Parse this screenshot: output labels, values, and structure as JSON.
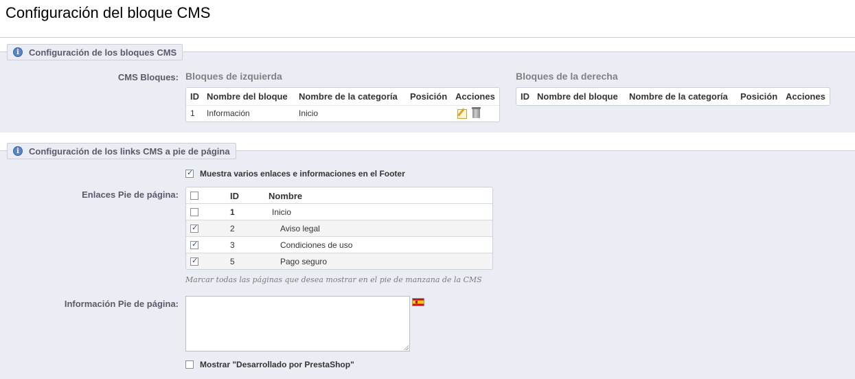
{
  "page": {
    "title": "Configuración del bloque CMS"
  },
  "section_blocks": {
    "legend": "Configuración de los bloques CMS",
    "label": "CMS Bloques:",
    "left": {
      "heading": "Bloques de izquierda",
      "columns": [
        "ID",
        "Nombre del bloque",
        "Nombre de la categoría",
        "Posición",
        "Acciones"
      ],
      "rows": [
        {
          "id": "1",
          "name": "Información",
          "category": "Inicio",
          "position": "",
          "actions": [
            "edit-icon",
            "delete-icon"
          ]
        }
      ]
    },
    "right": {
      "heading": "Bloques de la derecha",
      "columns": [
        "ID",
        "Nombre del bloque",
        "Nombre de la categoría",
        "Posición",
        "Acciones"
      ],
      "rows": []
    }
  },
  "section_footer": {
    "legend": "Configuración de los links CMS a pie de página",
    "show_footer_option": {
      "label": "Muestra varios enlaces e informaciones en el Footer",
      "checked": true
    },
    "links_label": "Enlaces Pie de página:",
    "links_table": {
      "columns": [
        "ID",
        "Nombre"
      ],
      "rows": [
        {
          "id": "1",
          "name": "Inicio",
          "checked": false,
          "bold": true
        },
        {
          "id": "2",
          "name": "Aviso legal",
          "checked": true,
          "bold": false
        },
        {
          "id": "3",
          "name": "Condiciones de uso",
          "checked": true,
          "bold": false
        },
        {
          "id": "5",
          "name": "Pago seguro",
          "checked": true,
          "bold": false
        }
      ]
    },
    "links_hint": "Marcar todas las páginas que desea mostrar en el pie de manzana de la CMS",
    "info_label": "Información Pie de página:",
    "info_value": "",
    "language_flag": "spain-flag-icon",
    "powered_option": {
      "label": "Mostrar \"Desarrollado por PrestaShop\"",
      "checked": false
    }
  },
  "colors": {
    "section_bg": "#ebedf4",
    "legend_text": "#585a69",
    "info_icon": "#5c84c6"
  }
}
